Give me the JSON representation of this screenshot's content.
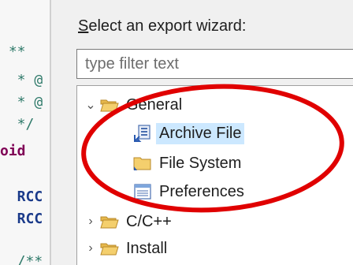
{
  "editor": {
    "lines": [
      " **",
      "  * @",
      "  * @",
      "  */",
      "oid",
      "",
      "  RCC",
      "  RCC",
      "  /**"
    ]
  },
  "wizard": {
    "prompt_pre": "",
    "prompt_mnemonic": "S",
    "prompt_post": "elect an export wizard:",
    "filter_placeholder": "type filter text",
    "filter_value": ""
  },
  "tree": {
    "items": [
      {
        "label": "General",
        "icon": "folder-open-icon",
        "expanded": true
      },
      {
        "label": "Archive File",
        "icon": "archive-file-icon",
        "selected": true
      },
      {
        "label": "File System",
        "icon": "folder-icon"
      },
      {
        "label": "Preferences",
        "icon": "preferences-icon"
      },
      {
        "label": "C/C++",
        "icon": "folder-icon",
        "expanded": false
      },
      {
        "label": "Install",
        "icon": "folder-icon",
        "expanded": false
      }
    ]
  },
  "colors": {
    "selection": "#cce8ff",
    "annotation": "#e00000",
    "folder": "#e6b84c"
  }
}
